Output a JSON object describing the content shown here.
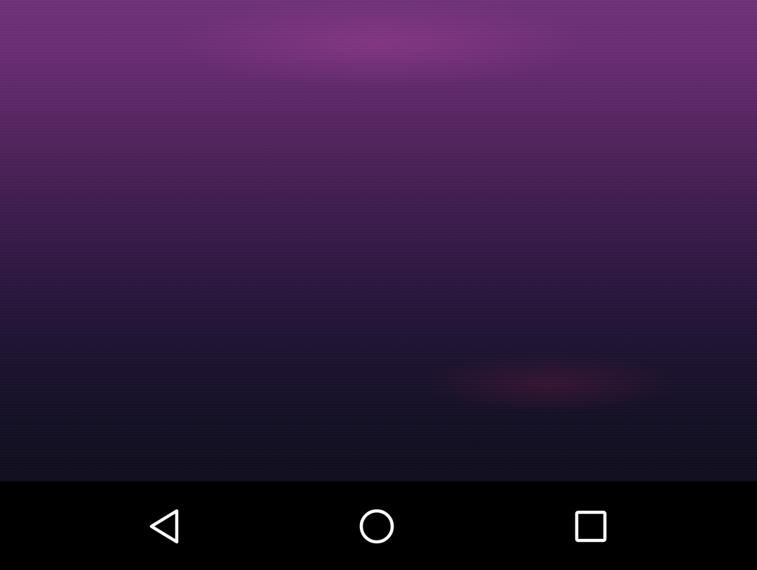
{
  "wallpaper": {
    "colors": {
      "top": "#6e3279",
      "middle": "#3b1c4c",
      "bottom": "#100e1f"
    }
  },
  "navigation_bar": {
    "background": "#000000",
    "icon_color": "#ffffff",
    "buttons": [
      {
        "name": "back",
        "icon": "back-triangle-icon"
      },
      {
        "name": "home",
        "icon": "home-circle-icon"
      },
      {
        "name": "recents",
        "icon": "recents-square-icon"
      }
    ]
  }
}
